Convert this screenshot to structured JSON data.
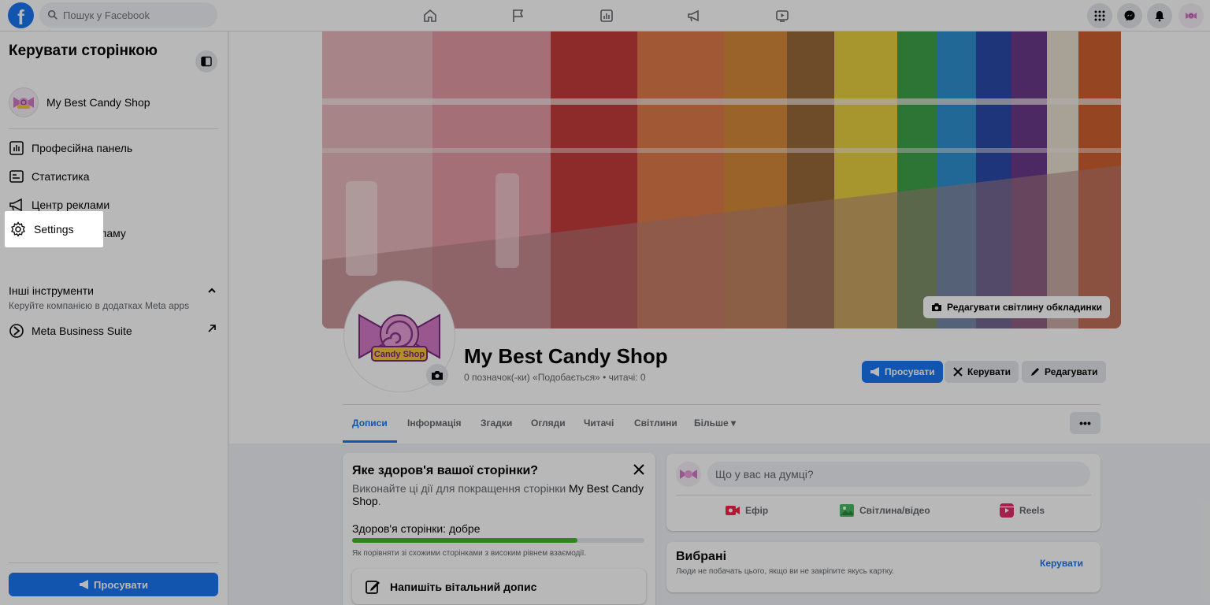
{
  "search": {
    "placeholder": "Пошук у Facebook"
  },
  "sidebar": {
    "title": "Керувати сторінкою",
    "page_name": "My Best Candy Shop",
    "items": [
      {
        "label": "Професійна панель",
        "icon": "dashboard-icon"
      },
      {
        "label": "Статистика",
        "icon": "insights-icon"
      },
      {
        "label": "Центр реклами",
        "icon": "megaphone-icon"
      },
      {
        "label": "Створити рекламу",
        "icon": "edit-icon"
      }
    ],
    "settings_label": "Settings",
    "other_tools_title": "Інші інструменти",
    "other_tools_sub": "Керуйте компанією в додатках Meta apps",
    "meta_suite_label": "Meta Business Suite",
    "promote_label": "Просувати"
  },
  "page": {
    "name": "My Best Candy Shop",
    "stats": "0 позначок(-ки) «Подобається» • читачі: 0",
    "edit_cover_label": "Редагувати світлину обкладинки",
    "logo_text": "Candy Shop",
    "actions": {
      "promote": "Просувати",
      "manage": "Керувати",
      "edit": "Редагувати"
    },
    "more_label": "•••"
  },
  "tabs": [
    "Дописи",
    "Інформація",
    "Згадки",
    "Огляди",
    "Читачі",
    "Світлини",
    "Більше ▾"
  ],
  "health": {
    "title": "Яке здоров'я вашої сторінки?",
    "desc_prefix": "Виконайте ці дії для покращення сторінки ",
    "desc_page": "My Best Candy Shop",
    "desc_suffix": ".",
    "label": "Здоров'я сторінки: добре",
    "progress": 0.77,
    "note": "Як порівняти зі схожими сторінками з високим рівнем взаємодії.",
    "welcome_label": "Напишіть вітальний допис"
  },
  "composer": {
    "placeholder": "Що у вас на думці?",
    "actions": [
      "Ефір",
      "Світлина/відео",
      "Reels"
    ]
  },
  "featured": {
    "title": "Вибрані",
    "subtitle": "Люди не побачать цього, якщо ви не закріпите якусь картку.",
    "manage_label": "Керувати"
  },
  "colors": {
    "brand": "#1877f2",
    "progress": "#42b72a"
  }
}
